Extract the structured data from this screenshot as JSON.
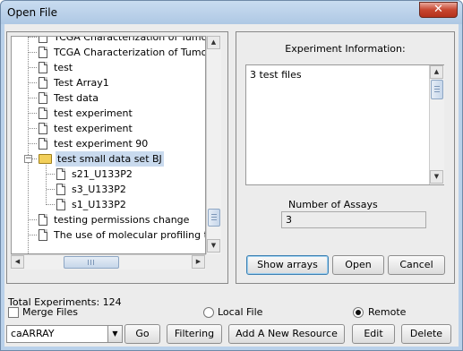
{
  "window": {
    "title": "Open File",
    "close_glyph": "✕"
  },
  "tree": {
    "items": [
      {
        "label": "TCGA Characterization of Tumor Sa",
        "icon": "document-icon",
        "level": 1
      },
      {
        "label": "TCGA Characterization of Tumor Sa",
        "icon": "document-icon",
        "level": 1
      },
      {
        "label": "test",
        "icon": "document-icon",
        "level": 1
      },
      {
        "label": "Test Array1",
        "icon": "document-icon",
        "level": 1
      },
      {
        "label": "Test data",
        "icon": "document-icon",
        "level": 1
      },
      {
        "label": "test experiment",
        "icon": "document-icon",
        "level": 1
      },
      {
        "label": "test experiment",
        "icon": "document-icon",
        "level": 1
      },
      {
        "label": "test experiment 90",
        "icon": "document-icon",
        "level": 1
      },
      {
        "label": "test small data set BJ",
        "icon": "open-folder-icon",
        "level": 1,
        "selected": true,
        "expanded": true
      },
      {
        "label": "s21_U133P2",
        "icon": "document-icon",
        "level": 2
      },
      {
        "label": "s3_U133P2",
        "icon": "document-icon",
        "level": 2
      },
      {
        "label": "s1_U133P2",
        "icon": "document-icon",
        "level": 2
      },
      {
        "label": "testing permissions change",
        "icon": "document-icon",
        "level": 1
      },
      {
        "label": "The use of molecular profiling to pr",
        "icon": "document-icon",
        "level": 1
      }
    ],
    "toggle_glyph": "−",
    "vertical_scroll_fraction": 0.92,
    "horizontal_scroll_fraction": 0.35
  },
  "left_panel": {
    "total_experiments": "Total Experiments: 124"
  },
  "right_panel": {
    "info_title": "Experiment Information:",
    "info_text": "3 test files",
    "assays_label": "Number of Assays",
    "assays_value": "3",
    "buttons": {
      "show_arrays": "Show arrays",
      "open": "Open",
      "cancel": "Cancel"
    }
  },
  "options": {
    "merge_files": "Merge Files",
    "merge_checked": false,
    "local_file": "Local File",
    "remote": "Remote",
    "selected_source": "remote"
  },
  "bottom_bar": {
    "source_value": "caARRAY",
    "go": "Go",
    "filtering": "Filtering",
    "add_resource": "Add A New Resource",
    "edit": "Edit",
    "delete": "Delete"
  },
  "colors": {
    "title_bar": "#b9d1ea",
    "selection": "#c9daee",
    "close_button": "#c7462f"
  }
}
